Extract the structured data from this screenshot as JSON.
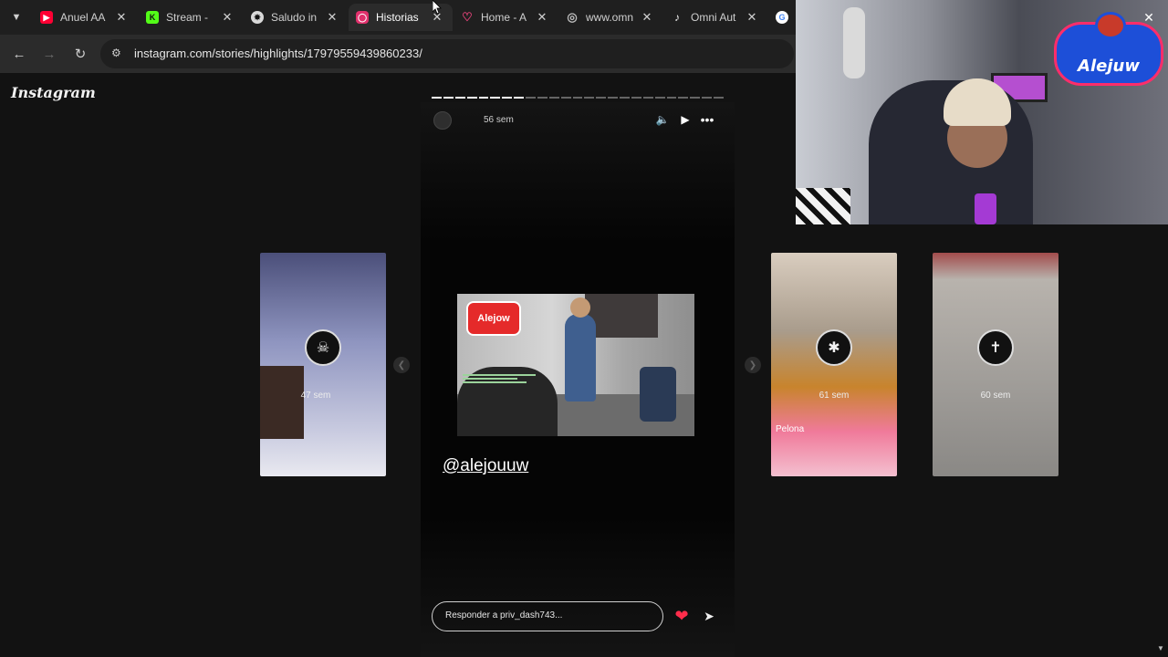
{
  "browser": {
    "tabs": [
      {
        "label": "Anuel AA",
        "favicon": "youtube-icon",
        "color": "#ff0033"
      },
      {
        "label": "Stream -",
        "favicon": "kick-icon",
        "color": "#53fc18"
      },
      {
        "label": "Saludo in",
        "favicon": "chatgpt-icon",
        "color": "#d9d9d9"
      },
      {
        "label": "Historias",
        "favicon": "instagram-icon",
        "color": "#e1306c",
        "active": true
      },
      {
        "label": "Home - A",
        "favicon": "heart-icon",
        "color": "#e5447a"
      },
      {
        "label": "www.omn",
        "favicon": "globe-icon",
        "color": "#bdbdbd"
      },
      {
        "label": "Omni Aut",
        "favicon": "tiktok-icon",
        "color": "#111111"
      },
      {
        "label": "",
        "favicon": "google-icon",
        "color": "#4285f4"
      }
    ],
    "url": "instagram.com/stories/highlights/17979559439860233/"
  },
  "page": {
    "logo": "Instagram",
    "story": {
      "time": "56 sem",
      "mention": "@alejouuw",
      "media_logo": "Alejow",
      "reply_placeholder": "Responder a priv_dash743...",
      "progress_total": 25,
      "progress_done": 8
    },
    "previews": [
      {
        "time": "47 sem",
        "avatar_icon": "skull-icon",
        "text": "",
        "bg": "#6f7aa6"
      },
      {
        "time": "61 sem",
        "avatar_icon": "swirl-icon",
        "text": "Pelona",
        "bg": "#b7a38e"
      },
      {
        "time": "60 sem",
        "avatar_icon": "cross-icon",
        "text": "",
        "bg": "#8d8b88"
      }
    ]
  },
  "overlay": {
    "brand": "Alejuw"
  },
  "colors": {
    "accent_heart": "#ff2d4b",
    "page_bg": "#121212",
    "tabbar_bg": "#1f1f1f",
    "toolbar_bg": "#2b2b2b"
  }
}
